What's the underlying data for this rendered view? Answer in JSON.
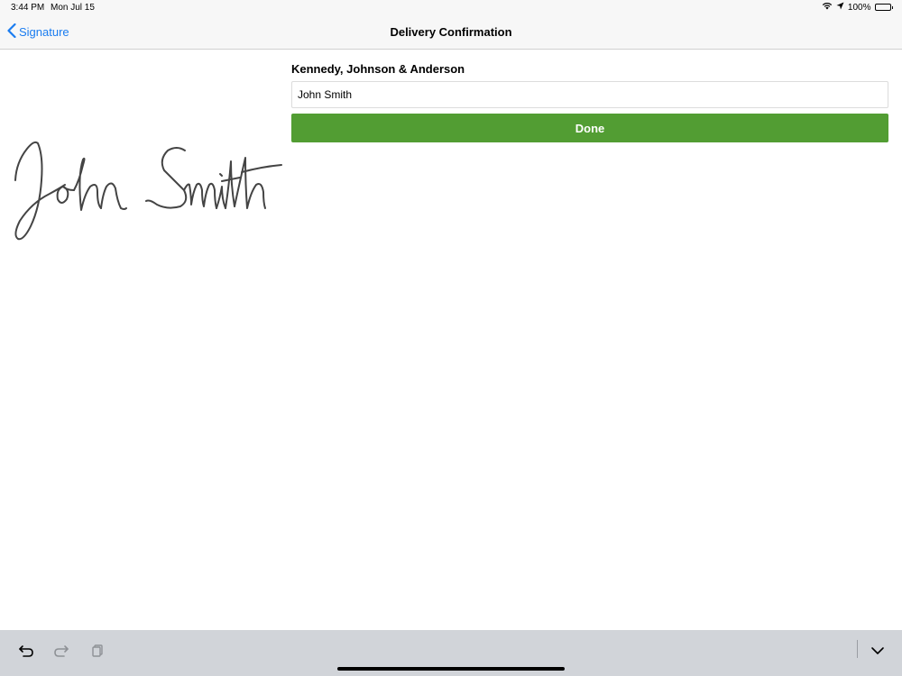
{
  "status_bar": {
    "time": "3:44 PM",
    "date": "Mon Jul 15",
    "battery_text": "100%",
    "icons": [
      "wifi-icon",
      "location-arrow-icon",
      "battery-icon"
    ]
  },
  "nav": {
    "back_label": "Signature",
    "title": "Delivery Confirmation",
    "accent_color": "#1a7cf0"
  },
  "signature": {
    "text": "John Smith"
  },
  "form": {
    "company_name": "Kennedy, Johnson & Anderson",
    "name_value": "John Smith",
    "done_label": "Done",
    "done_color": "#529d33"
  },
  "keyboard_toolbar": {
    "icons": [
      "undo-icon",
      "redo-icon",
      "paste-icon",
      "dismiss-keyboard-icon"
    ]
  }
}
